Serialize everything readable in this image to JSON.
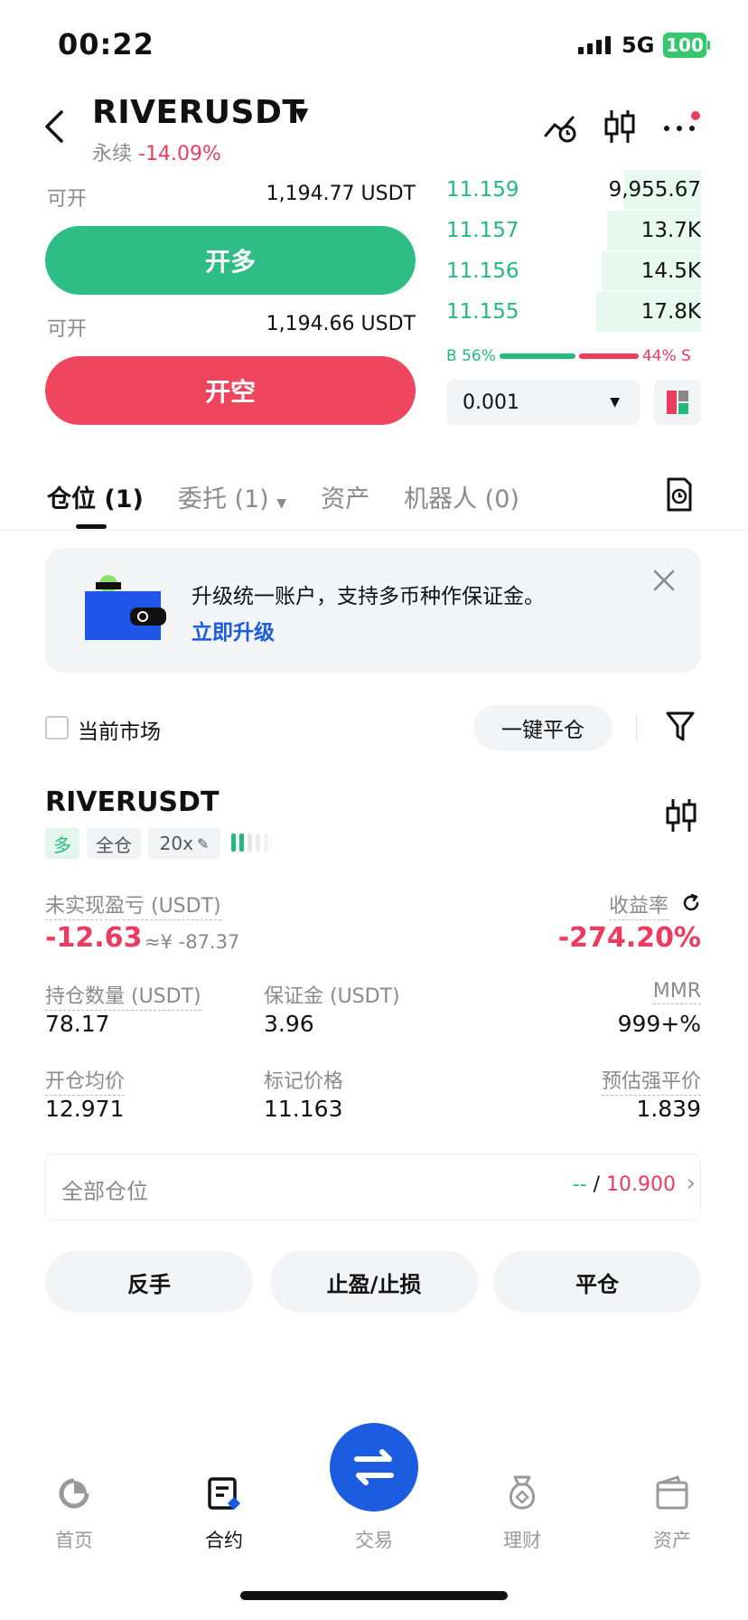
{
  "status_bar": {
    "time": "00:22",
    "network": "5G",
    "battery": "100"
  },
  "header": {
    "symbol": "RIVERUSDT",
    "type": "永续",
    "change": "-14.09%"
  },
  "trade": {
    "avail_label": "可开",
    "avail_long": "1,194.77 USDT",
    "avail_short": "1,194.66 USDT",
    "open_long": "开多",
    "open_short": "开空"
  },
  "order_book": {
    "rows": [
      {
        "price": "11.159",
        "size": "9,955.67",
        "depth": 0.3
      },
      {
        "price": "11.157",
        "size": "13.7K",
        "depth": 0.37
      },
      {
        "price": "11.156",
        "size": "14.5K",
        "depth": 0.39
      },
      {
        "price": "11.155",
        "size": "17.8K",
        "depth": 0.41
      }
    ],
    "buy_ratio": "B 56%",
    "sell_ratio": "44% S",
    "buy_fraction": 0.56,
    "precision": "0.001"
  },
  "tabs": [
    {
      "label": "仓位 (1)"
    },
    {
      "label": "委托 (1)"
    },
    {
      "label": "资产"
    },
    {
      "label": "机器人 (0)"
    }
  ],
  "banner": {
    "text": "升级统一账户，支持多币种作保证金。",
    "link": "立即升级"
  },
  "filter": {
    "current_market": "当前市场",
    "close_all": "一键平仓"
  },
  "position": {
    "symbol": "RIVERUSDT",
    "side": "多",
    "margin_mode": "全仓",
    "leverage": "20x",
    "pnl_label": "未实现盈亏 (USDT)",
    "pnl": "-12.63",
    "pnl_cny": "≈¥ -87.37",
    "roe_label": "收益率",
    "roe": "-274.20%",
    "size_label": "持仓数量 (USDT)",
    "size": "78.17",
    "margin_label": "保证金 (USDT)",
    "margin": "3.96",
    "mmr_label": "MMR",
    "mmr": "999+%",
    "entry_label": "开仓均价",
    "entry": "12.971",
    "mark_label": "标记价格",
    "mark": "11.163",
    "liq_label": "预估强平价",
    "liq": "1.839"
  },
  "all_positions": {
    "label": "全部仓位",
    "tp": "--",
    "sep": " / ",
    "sl": "10.900"
  },
  "actions": {
    "reverse": "反手",
    "tpsl": "止盈/止损",
    "close": "平仓"
  },
  "nav": {
    "home": "首页",
    "futures": "合约",
    "trade": "交易",
    "earn": "理财",
    "assets": "资产"
  }
}
